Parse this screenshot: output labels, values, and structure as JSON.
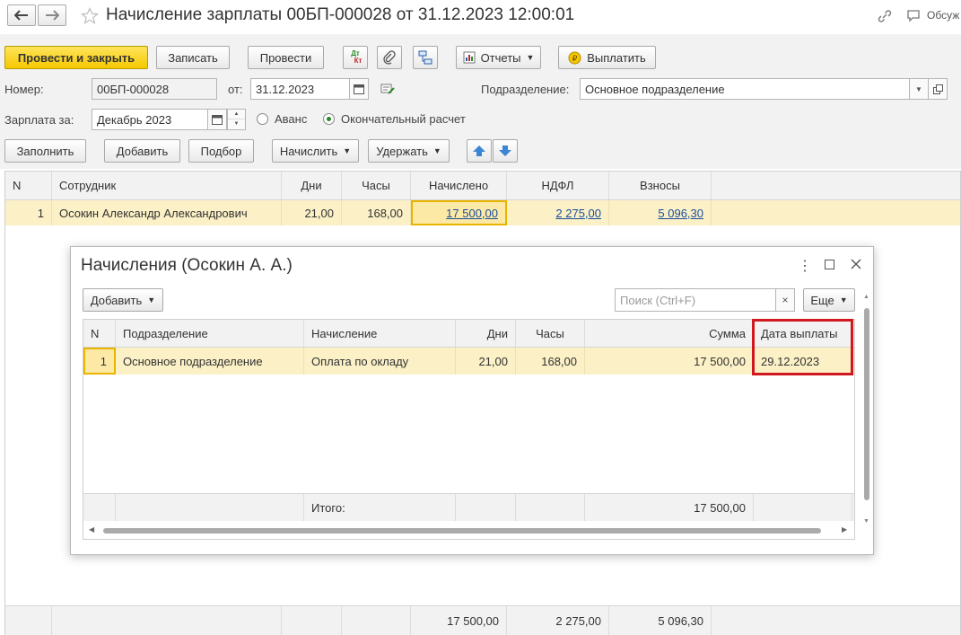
{
  "window": {
    "title": "Начисление зарплаты 00БП-000028 от 31.12.2023 12:00:01",
    "discuss_label": "Обсуж"
  },
  "toolbar": {
    "post_close": "Провести и закрыть",
    "save": "Записать",
    "post": "Провести",
    "dtkt_top": "Дт",
    "dtkt_bottom": "Кт",
    "reports": "Отчеты",
    "pay": "Выплатить"
  },
  "header": {
    "number_label": "Номер:",
    "number_value": "00БП-000028",
    "date_label": "от:",
    "date_value": "31.12.2023",
    "division_label": "Подразделение:",
    "division_value": "Основное подразделение",
    "salary_for_label": "Зарплата за:",
    "salary_for_value": "Декабрь 2023",
    "radio_advance": "Аванс",
    "radio_final": "Окончательный расчет"
  },
  "table_toolbar": {
    "fill": "Заполнить",
    "add": "Добавить",
    "pick": "Подбор",
    "accrue": "Начислить",
    "withhold": "Удержать"
  },
  "main_table": {
    "columns": [
      "N",
      "Сотрудник",
      "Дни",
      "Часы",
      "Начислено",
      "НДФЛ",
      "Взносы"
    ],
    "rows": [
      {
        "n": "1",
        "employee": "Осокин Александр Александрович",
        "days": "21,00",
        "hours": "168,00",
        "accrued": "17 500,00",
        "ndfl": "2 275,00",
        "contrib": "5 096,30"
      }
    ],
    "totals": {
      "accrued": "17 500,00",
      "ndfl": "2 275,00",
      "contrib": "5 096,30"
    }
  },
  "dialog": {
    "title": "Начисления (Осокин А. А.)",
    "add": "Добавить",
    "search_placeholder": "Поиск (Ctrl+F)",
    "more": "Еще",
    "columns": [
      "N",
      "Подразделение",
      "Начисление",
      "Дни",
      "Часы",
      "Сумма",
      "Дата выплаты"
    ],
    "rows": [
      {
        "n": "1",
        "division": "Основное подразделение",
        "accrual": "Оплата по окладу",
        "days": "21,00",
        "hours": "168,00",
        "sum": "17 500,00",
        "pay_date": "29.12.2023"
      }
    ],
    "footer_label": "Итого:",
    "footer_sum": "17 500,00"
  },
  "colors": {
    "accent_yellow": "#f5c800",
    "selected_row": "#fbf0c6",
    "highlight_red": "#d0191e",
    "link_blue": "#1a4f9c"
  }
}
